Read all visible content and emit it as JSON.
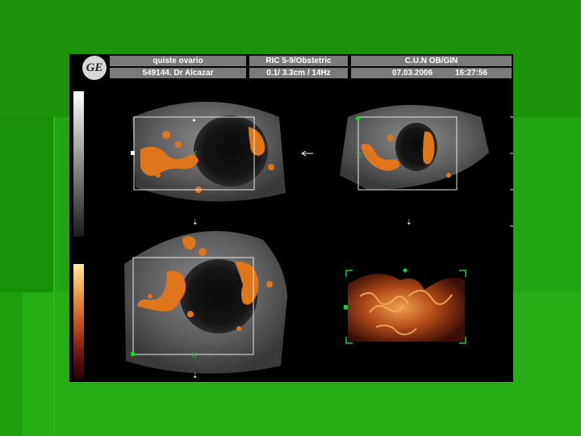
{
  "header": {
    "logo_text": "GE",
    "row1": {
      "study": "quiste ovario",
      "probe": "RIC 5-9/Obstetric",
      "institution": "C.U.N OB/GIN"
    },
    "row2": {
      "patient": "549144. Dr Alcazar",
      "settings": "0.1/ 3.3cm / 14Hz",
      "date": "07.03.2006",
      "time": "16:27:56"
    }
  },
  "colors": {
    "background": "#1f9a0c",
    "panel": "#000000",
    "header_cell": "#7a7a7a",
    "flow": "#e0761c",
    "marker": "#22cc33"
  },
  "views": [
    "view-a-transverse",
    "view-b-longitudinal",
    "view-c-coronal",
    "view-3d-render"
  ]
}
